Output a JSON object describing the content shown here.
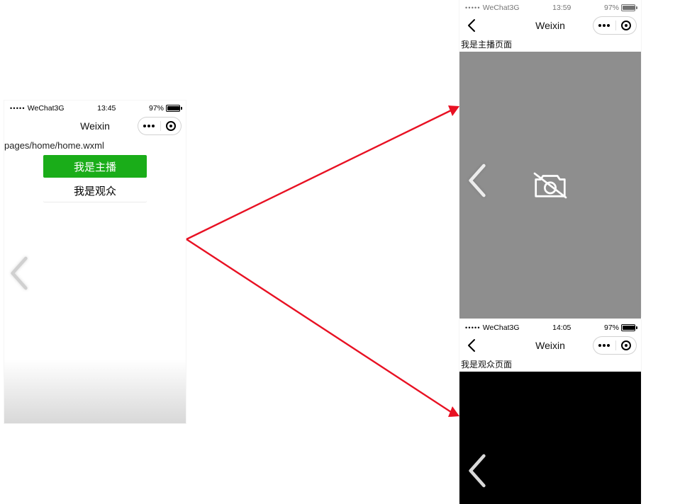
{
  "status": {
    "signal_dots": "•••••",
    "carrier": "WeChat3G",
    "battery_text": "97%"
  },
  "phone_home": {
    "time": "13:45",
    "title": "Weixin",
    "page_path": "pages/home/home.wxml",
    "btn_host": "我是主播",
    "btn_viewer": "我是观众"
  },
  "phone_host": {
    "time": "13:59",
    "title": "Weixin",
    "heading": "我是主播页面"
  },
  "phone_viewer": {
    "time": "14:05",
    "title": "Weixin",
    "heading": "我是观众页面"
  }
}
